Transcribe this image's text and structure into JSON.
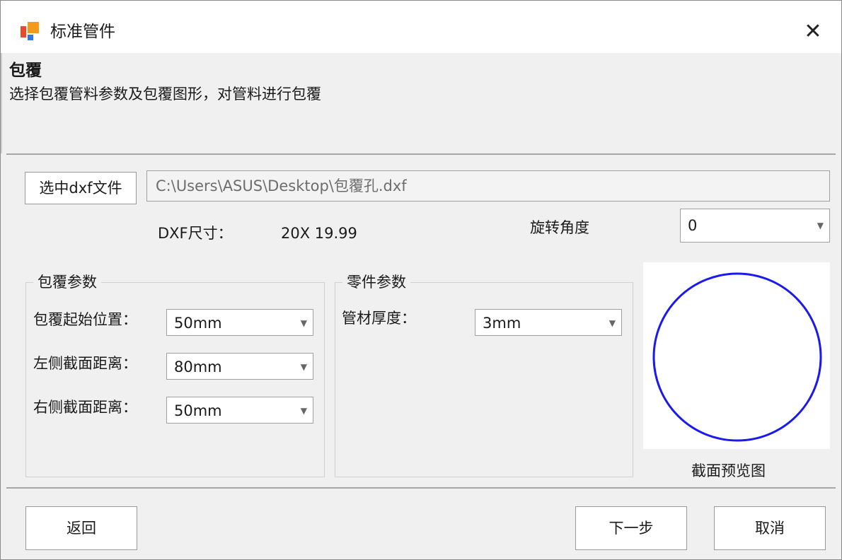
{
  "window": {
    "title": "标准管件",
    "close_glyph": "✕",
    "logo_icon": "app-logo-icon"
  },
  "header": {
    "title": "包覆",
    "description": "选择包覆管料参数及包覆图形，对管料进行包覆"
  },
  "file": {
    "button_label": "选中dxf文件",
    "path": "C:\\Users\\ASUS\\Desktop\\包覆孔.dxf"
  },
  "dxf": {
    "label": "DXF尺寸：",
    "value": "20X 19.99"
  },
  "rotation": {
    "label": "旋转角度",
    "value": "0"
  },
  "wrap_params": {
    "legend": "包覆参数",
    "fields": [
      {
        "label": "包覆起始位置：",
        "value": "50mm"
      },
      {
        "label": "左侧截面距离：",
        "value": "80mm"
      },
      {
        "label": "右侧截面距离：",
        "value": "50mm"
      }
    ]
  },
  "part_params": {
    "legend": "零件参数",
    "fields": [
      {
        "label": "管材厚度：",
        "value": "3mm"
      }
    ]
  },
  "preview": {
    "label": "截面预览图",
    "stroke_color": "#1a1aee"
  },
  "buttons": {
    "back": "返回",
    "next": "下一步",
    "cancel": "取消"
  },
  "dropdown_arrow": "▼"
}
